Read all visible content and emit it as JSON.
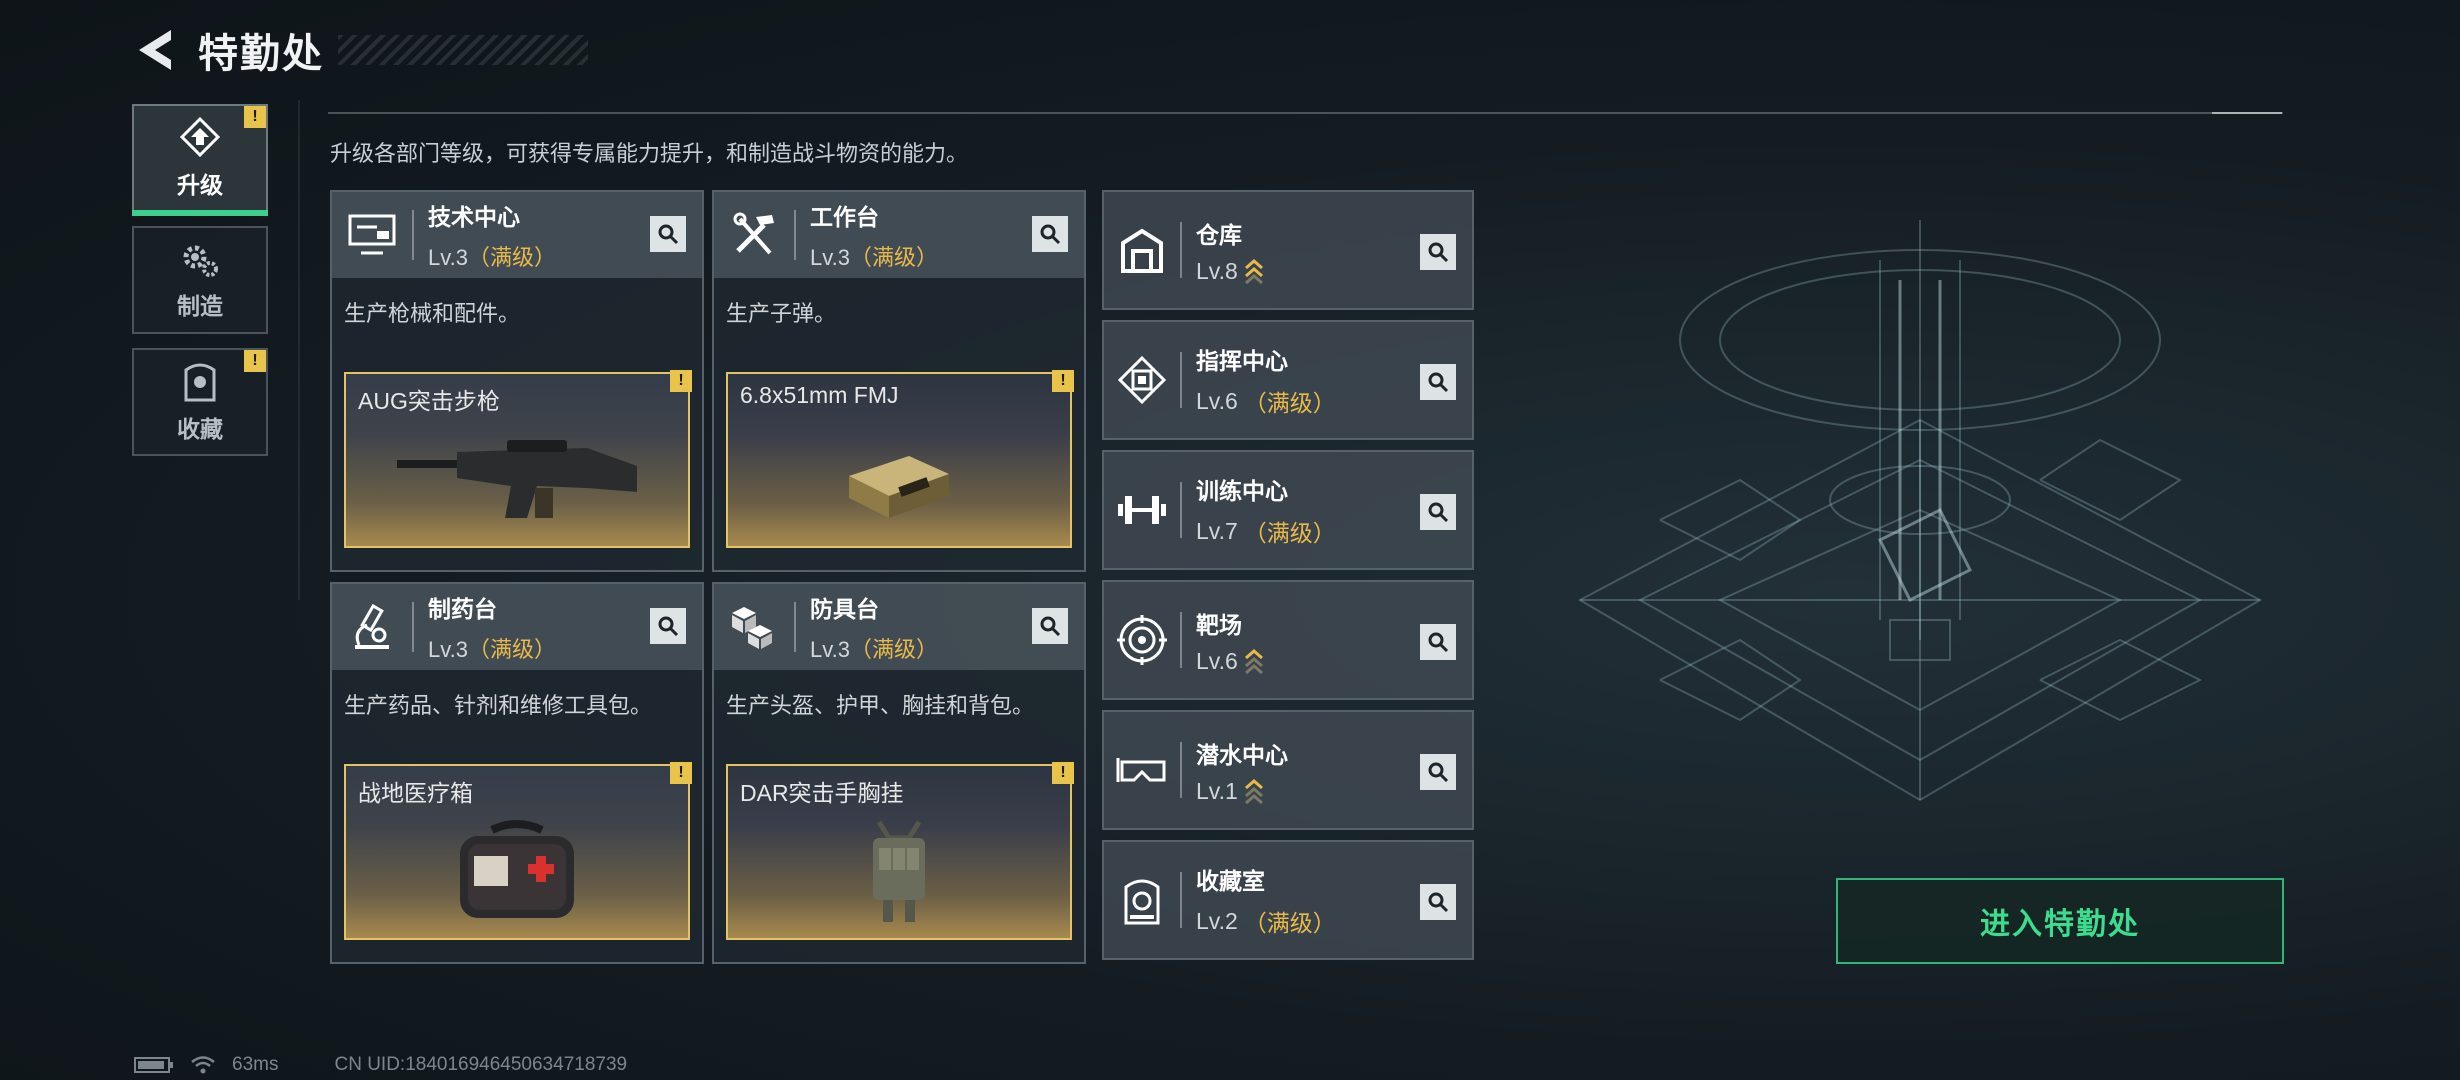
{
  "header": {
    "title": "特勤处"
  },
  "tabs": [
    {
      "label": "升级",
      "icon": "upgrade-icon",
      "active": true,
      "alert": "!"
    },
    {
      "label": "制造",
      "icon": "gears-icon",
      "active": false
    },
    {
      "label": "收藏",
      "icon": "collection-icon",
      "active": false,
      "alert": "!"
    }
  ],
  "subtitle": "升级各部门等级，可获得专属能力提升，和制造战斗物资的能力。",
  "cards": [
    {
      "name": "技术中心",
      "level": "Lv.3",
      "status": "（满级）",
      "desc": "生产枪械和配件。",
      "item": "AUG突击步枪",
      "alert": "!",
      "icon": "monitor-icon"
    },
    {
      "name": "工作台",
      "level": "Lv.3",
      "status": "（满级）",
      "desc": "生产子弹。",
      "item": "6.8x51mm FMJ",
      "alert": "!",
      "icon": "tools-icon"
    },
    {
      "name": "制药台",
      "level": "Lv.3",
      "status": "（满级）",
      "desc": "生产药品、针剂和维修工具包。",
      "item": "战地医疗箱",
      "alert": "!",
      "icon": "microscope-icon"
    },
    {
      "name": "防具台",
      "level": "Lv.3",
      "status": "（满级）",
      "desc": "生产头盔、护甲、胸挂和背包。",
      "item": "DAR突击手胸挂",
      "alert": "!",
      "icon": "boxes-icon"
    }
  ],
  "rows": [
    {
      "name": "仓库",
      "level": "Lv.8",
      "status": "",
      "upgradable": true,
      "icon": "warehouse-icon"
    },
    {
      "name": "指挥中心",
      "level": "Lv.6",
      "status": "（满级）",
      "upgradable": false,
      "icon": "chip-icon"
    },
    {
      "name": "训练中心",
      "level": "Lv.7",
      "status": "（满级）",
      "upgradable": false,
      "icon": "dumbbell-icon"
    },
    {
      "name": "靶场",
      "level": "Lv.6",
      "status": "",
      "upgradable": true,
      "icon": "target-icon"
    },
    {
      "name": "潜水中心",
      "level": "Lv.1",
      "status": "",
      "upgradable": true,
      "icon": "goggles-icon"
    },
    {
      "name": "收藏室",
      "level": "Lv.2",
      "status": "（满级）",
      "upgradable": false,
      "icon": "vault-icon"
    }
  ],
  "enter_button": "进入特勤处",
  "status": {
    "ping": "63ms",
    "uid": "CN UID:18401694645063471873​9"
  },
  "colors": {
    "accent_green": "#3ecf8e",
    "maxed_gold": "#e9b949",
    "alert_yellow": "#e8c44a"
  }
}
